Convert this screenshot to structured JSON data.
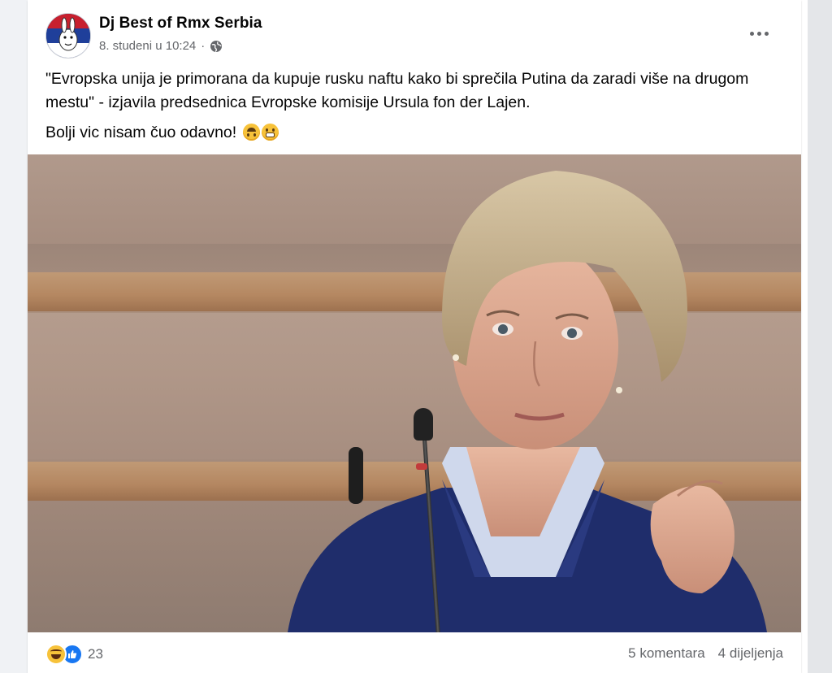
{
  "post": {
    "author": "Dj Best of Rmx Serbia",
    "timestamp": "8. studeni u 10:24",
    "separator": "·",
    "privacy_icon": "globe-icon",
    "more_icon": "more-options-icon",
    "text_line1": "\"Evropska unija je primorana da kupuje rusku naftu kako bi sprečila Putina da zaradi više na drugom mestu\" - izjavila predsednica Evropske komisije Ursula fon der Lajen.",
    "text_line2": "Bolji vic nisam čuo odavno!",
    "emojis": [
      "upside-down-face",
      "grinning-face-with-teeth"
    ]
  },
  "footer": {
    "reaction_icons": [
      "haha-icon",
      "like-icon"
    ],
    "reaction_count": "23",
    "comments": "5 komentara",
    "shares": "4 dijeljenja"
  },
  "colors": {
    "background": "#f0f2f5",
    "card": "#ffffff",
    "secondary_text": "#65676b",
    "like_blue": "#1877f2"
  }
}
